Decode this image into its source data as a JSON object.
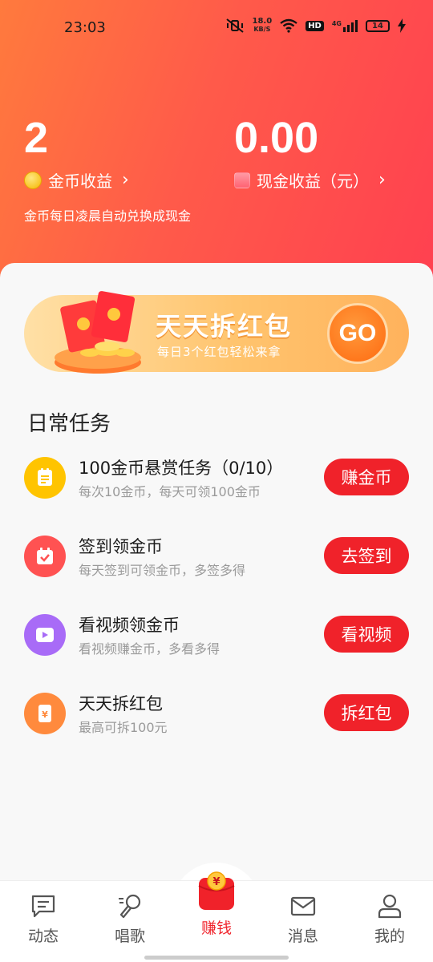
{
  "status_bar": {
    "time": "23:03",
    "net_speed_value": "18.0",
    "net_speed_unit": "KB/S",
    "hd_label": "HD",
    "signal_label": "4G",
    "battery": "14"
  },
  "earnings": {
    "coins": {
      "value": "2",
      "label": "金币收益"
    },
    "cash": {
      "value": "0.00",
      "label": "现金收益（元）"
    },
    "note": "金币每日凌晨自动兑换成现金"
  },
  "banner": {
    "title": "天天拆红包",
    "subtitle": "每日3个红包轻松来拿",
    "go_label": "GO"
  },
  "daily_tasks": {
    "title": "日常任务",
    "items": [
      {
        "name": "100金币悬赏任务（0/10）",
        "desc": "每次10金币，每天可领100金币",
        "button": "赚金币",
        "icon": "list-icon",
        "color": "#ffc400"
      },
      {
        "name": "签到领金币",
        "desc": "每天签到可领金币，多签多得",
        "button": "去签到",
        "icon": "calendar-check-icon",
        "color": "#ff5252"
      },
      {
        "name": "看视频领金币",
        "desc": "看视频赚金币，多看多得",
        "button": "看视频",
        "icon": "play-video-icon",
        "color": "#a86bf7"
      },
      {
        "name": "天天拆红包",
        "desc": "最高可拆100元",
        "button": "拆红包",
        "icon": "red-envelope-icon",
        "color": "#ff8a3d"
      }
    ]
  },
  "tabbar": {
    "items": [
      {
        "label": "动态",
        "icon": "chat-icon"
      },
      {
        "label": "唱歌",
        "icon": "microphone-icon"
      },
      {
        "label": "赚钱",
        "icon": "red-envelope-icon",
        "active": true
      },
      {
        "label": "消息",
        "icon": "mail-icon"
      },
      {
        "label": "我的",
        "icon": "user-icon"
      }
    ]
  },
  "colors": {
    "accent_red": "#f0222a",
    "header_start": "#ff7a3d",
    "header_end": "#ff4050"
  }
}
